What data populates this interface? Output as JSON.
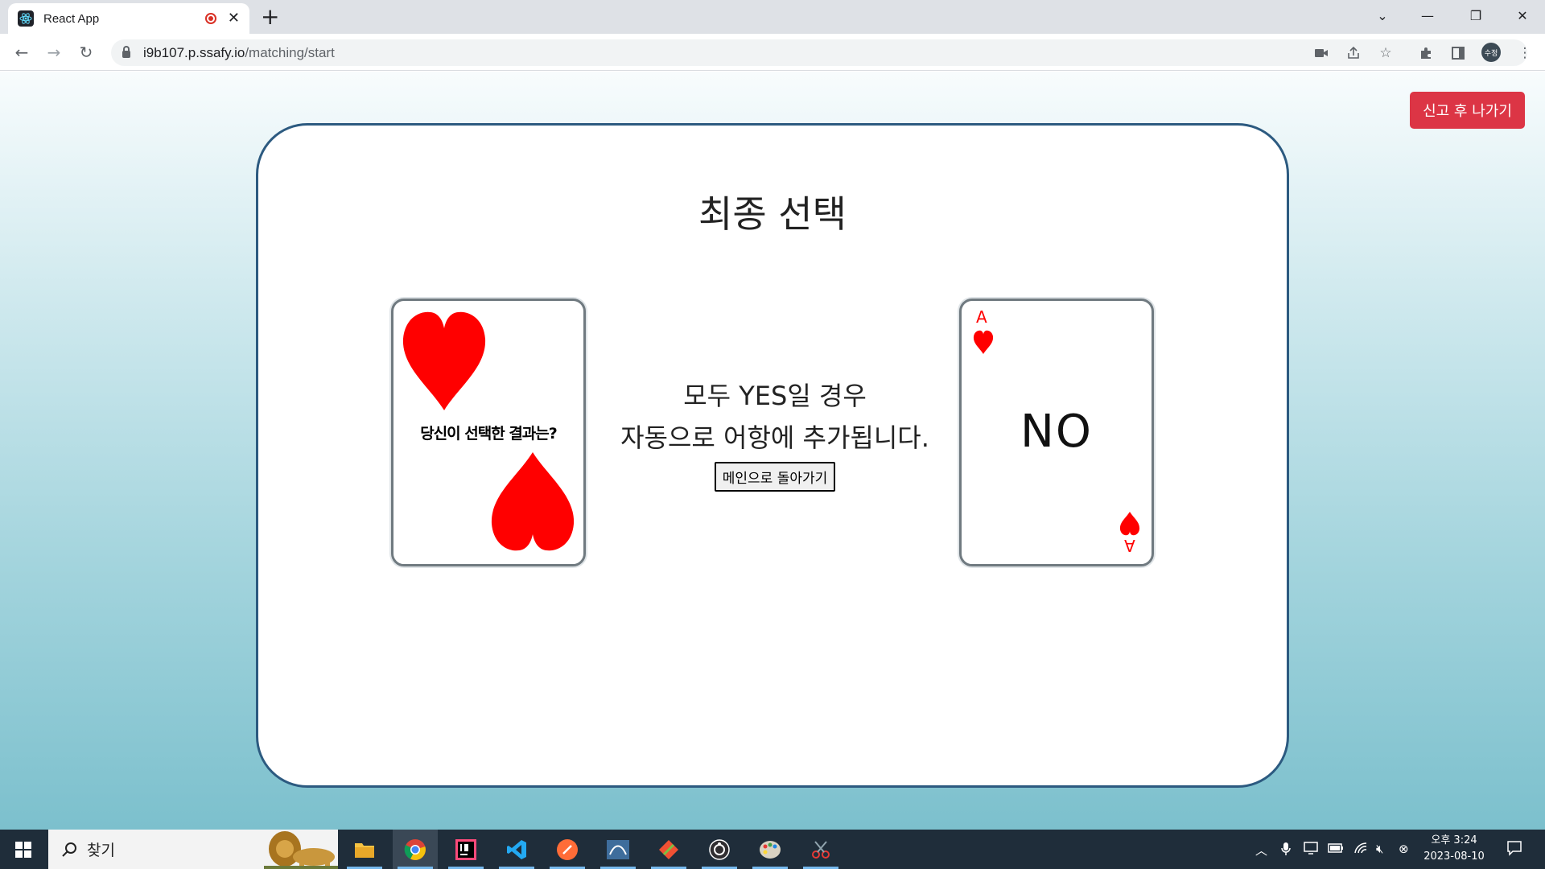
{
  "browser": {
    "tab_title": "React App",
    "url_host": "i9b107.p.ssafy.io",
    "url_path": "/matching/start",
    "profile_initials": "수정"
  },
  "page": {
    "report_button": "신고 후 나가기",
    "title": "최종 선택",
    "left_card_text": "당신이 선택한 결과는?",
    "right_card_text": "NO",
    "right_card_rank": "A",
    "message_line1": "모두 YES일 경우",
    "message_line2": "자동으로 어항에 추가됩니다.",
    "main_button": "메인으로 돌아가기"
  },
  "taskbar": {
    "search_placeholder": "찾기",
    "clock_time": "오후 3:24",
    "clock_date": "2023-08-10",
    "apps": [
      "file-explorer",
      "chrome",
      "intellij",
      "vscode",
      "postman",
      "mysql-workbench",
      "git",
      "obs",
      "paint",
      "snipping-tool"
    ]
  },
  "colors": {
    "accent_red": "#dc3545",
    "panel_border": "#2c5a80",
    "heart_red": "#ff0000",
    "taskbar_bg": "#1f2d3a"
  }
}
